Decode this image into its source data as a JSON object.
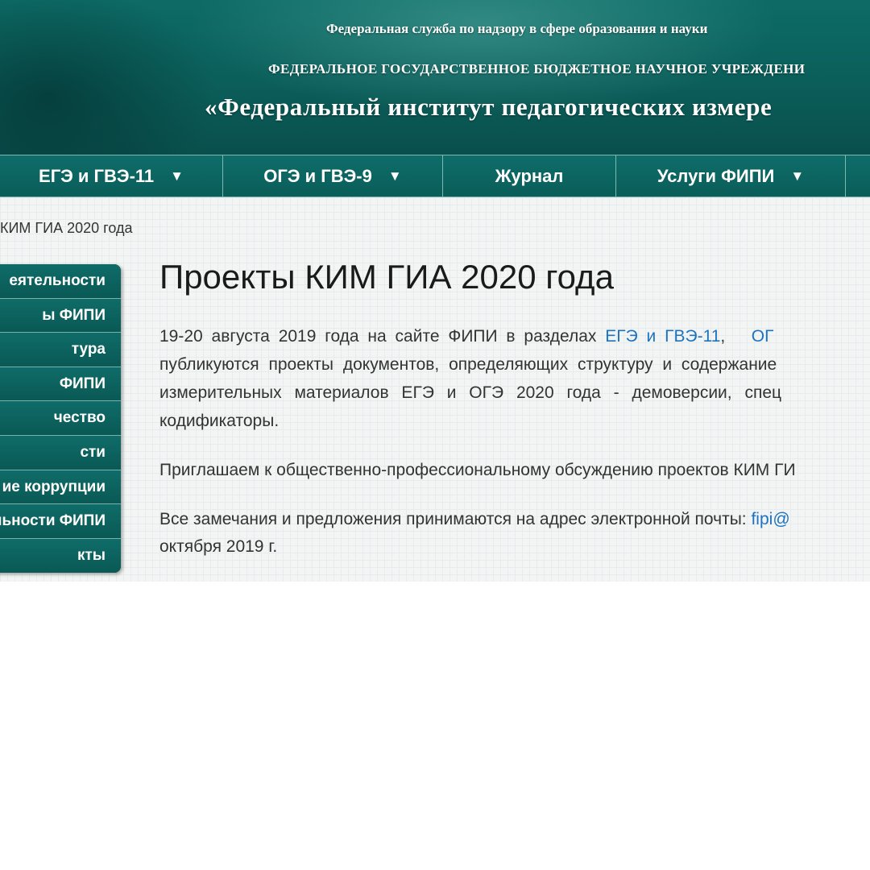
{
  "header": {
    "line1": "Федеральная служба по надзору в сфере образования и науки",
    "line2": "ФЕДЕРАЛЬНОЕ ГОСУДАРСТВЕННОЕ БЮДЖЕТНОЕ НАУЧНОЕ УЧРЕЖДЕНИ",
    "line3": "«Федеральный институт педагогических измере"
  },
  "nav": {
    "items": [
      {
        "label": "ЕГЭ и ГВЭ-11",
        "caret": "▼"
      },
      {
        "label": "ОГЭ и ГВЭ-9",
        "caret": "▼"
      },
      {
        "label": "Журнал"
      },
      {
        "label": "Услуги ФИПИ",
        "caret": "▼"
      }
    ]
  },
  "breadcrumb": {
    "current": "КИМ ГИА 2020 года"
  },
  "sidebar": {
    "items": [
      {
        "label": "еятельности"
      },
      {
        "label": "ы ФИПИ"
      },
      {
        "label": "тура"
      },
      {
        "label": "ФИПИ"
      },
      {
        "label": "чество"
      },
      {
        "label": "сти"
      },
      {
        "label": "ие коррупции"
      },
      {
        "label": "льности ФИПИ"
      },
      {
        "label": "кты"
      }
    ]
  },
  "main": {
    "title": "Проекты КИМ ГИА 2020 года",
    "p1": {
      "intro": "19-20 августа 2019 года на сайте ФИПИ в разделах",
      "link1": "ЕГЭ и ГВЭ-11",
      "sep": ",",
      "link2": "ОГ",
      "line2": "публикуются проекты документов, определяющих структуру и содержание",
      "line3": "измерительных материалов ЕГЭ и ОГЭ 2020 года - демоверсии, спец",
      "line4": "кодификаторы."
    },
    "p2": "Приглашаем к общественно-профессиональному обсуждению проектов КИМ ГИ",
    "p3": {
      "line1": "Все замечания и предложения принимаются на адрес электронной почты:",
      "email": "fipi@",
      "line2": "октября 2019 г."
    }
  },
  "colors": {
    "header_teal": "#0b5e5a",
    "nav_teal": "#0a5d59",
    "link_blue": "#1e73be",
    "text": "#333333"
  }
}
